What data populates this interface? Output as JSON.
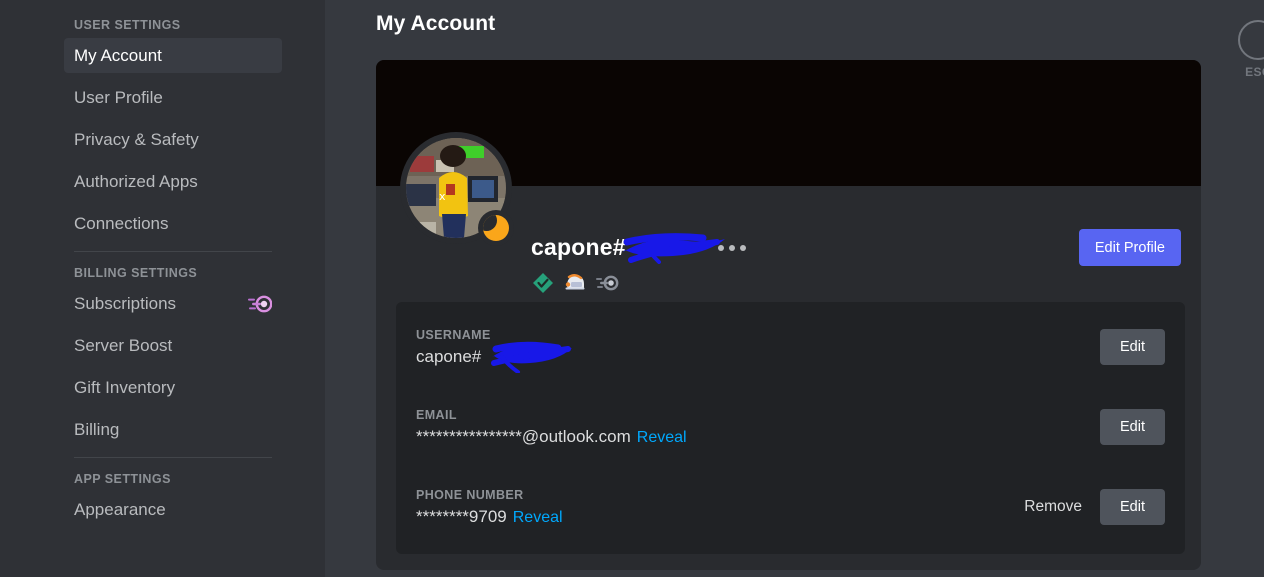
{
  "sidebar": {
    "sections": [
      {
        "header": "USER SETTINGS",
        "items": [
          {
            "label": "My Account",
            "active": true,
            "icon": null
          },
          {
            "label": "User Profile",
            "active": false,
            "icon": null
          },
          {
            "label": "Privacy & Safety",
            "active": false,
            "icon": null
          },
          {
            "label": "Authorized Apps",
            "active": false,
            "icon": null
          },
          {
            "label": "Connections",
            "active": false,
            "icon": null
          }
        ]
      },
      {
        "header": "BILLING SETTINGS",
        "items": [
          {
            "label": "Subscriptions",
            "active": false,
            "icon": "nitro-wheel-icon"
          },
          {
            "label": "Server Boost",
            "active": false,
            "icon": null
          },
          {
            "label": "Gift Inventory",
            "active": false,
            "icon": null
          },
          {
            "label": "Billing",
            "active": false,
            "icon": null
          }
        ]
      },
      {
        "header": "APP SETTINGS",
        "items": [
          {
            "label": "Appearance",
            "active": false,
            "icon": null
          }
        ]
      }
    ]
  },
  "main": {
    "page_title": "My Account",
    "profile": {
      "username": "capone#",
      "username_redacted": true,
      "status": "idle",
      "status_icon": "crescent-moon-icon",
      "more_options_icon": "more-horizontal-icon",
      "badges": [
        {
          "name": "verified-diamond-badge",
          "color": "#26a17b"
        },
        {
          "name": "helmet-badge",
          "color": "#f0f2f5"
        },
        {
          "name": "nitro-wheel-badge",
          "color": "#8a8f98"
        }
      ],
      "edit_profile_label": "Edit Profile"
    },
    "fields": [
      {
        "label": "USERNAME",
        "value": "capone#",
        "redacted": true,
        "reveal_label": null,
        "remove_label": null,
        "edit_label": "Edit"
      },
      {
        "label": "EMAIL",
        "value": "****************@outlook.com",
        "redacted": false,
        "reveal_label": "Reveal",
        "remove_label": null,
        "edit_label": "Edit"
      },
      {
        "label": "PHONE NUMBER",
        "value": "********9709",
        "redacted": false,
        "reveal_label": "Reveal",
        "remove_label": "Remove",
        "edit_label": "Edit"
      }
    ]
  },
  "close": {
    "label": "ESC",
    "icon": "close-circle-icon"
  },
  "colors": {
    "accent": "#5865f2",
    "link": "#00a8fc",
    "sidebar_bg": "#2f3136",
    "main_bg": "#36393f",
    "card_bg": "#292b2f",
    "fields_bg": "#202225",
    "banner_bg": "#0a0503",
    "redaction": "#1818e8",
    "status_idle": "#faa61a"
  }
}
